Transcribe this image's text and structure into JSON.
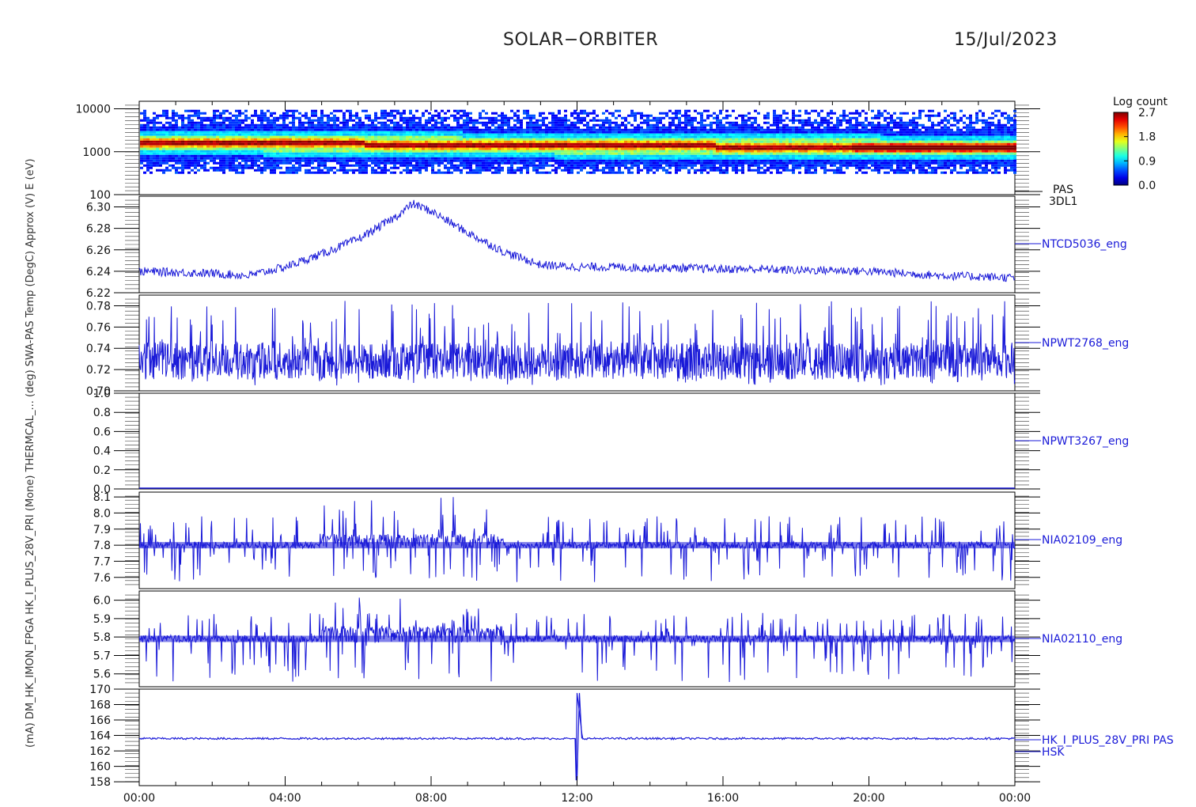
{
  "header": {
    "title": "SOLAR−ORBITER",
    "date": "15/Jul/2023"
  },
  "colors": {
    "trace": "#1a1ad8",
    "axis": "#000000",
    "label": "#1a1ad8"
  },
  "colorbar": {
    "title": "Log count",
    "ticks": [
      "2.7",
      "1.8",
      "0.9",
      "0.0"
    ],
    "range": [
      0.0,
      2.7
    ]
  },
  "ylabel_overlap": "(mA) DM_HK_IMON_FPGA HK_I_PLUS_28V_PRI (Mone) THERMCAL_... (deg) SWA-PAS Temp (DegC) Approx (V) E (eV)",
  "chart_data": [
    {
      "type": "heatmap",
      "name": "PAS 3DL1",
      "label": [
        "PAS",
        "3DL1"
      ],
      "y_scale": "log",
      "ylim": [
        100,
        15000
      ],
      "yticks": [
        "10000",
        "1000",
        "100"
      ],
      "z_range": [
        0.0,
        2.7
      ],
      "band_center_eV": [
        1700,
        1700,
        1650,
        1600,
        1550,
        1500,
        1450,
        1450,
        1400,
        1400,
        1350,
        1300
      ],
      "band_center_hours": [
        0,
        2,
        4,
        6,
        8,
        10,
        12,
        14,
        16,
        18,
        20,
        24
      ]
    },
    {
      "type": "line",
      "name": "NTCD5036_eng",
      "label": "NTCD5036_eng",
      "ylim": [
        6.22,
        6.31
      ],
      "yticks": [
        "6.30",
        "6.28",
        "6.26",
        "6.24",
        "6.22"
      ],
      "x_hours": [
        0,
        1,
        2,
        3,
        4,
        5,
        6,
        7,
        7.5,
        8,
        9,
        10,
        11,
        12,
        13,
        14,
        15,
        16,
        17,
        18,
        19,
        20,
        21,
        22,
        23,
        24
      ],
      "y": [
        6.24,
        6.239,
        6.238,
        6.236,
        6.244,
        6.256,
        6.27,
        6.29,
        6.303,
        6.296,
        6.276,
        6.258,
        6.246,
        6.244,
        6.244,
        6.243,
        6.243,
        6.242,
        6.242,
        6.241,
        6.241,
        6.24,
        6.238,
        6.236,
        6.235,
        6.234
      ]
    },
    {
      "type": "line",
      "name": "NPWT2768_eng",
      "label": "NPWT2768_eng",
      "ylim": [
        0.7,
        0.79
      ],
      "yticks": [
        "0.78",
        "0.76",
        "0.74",
        "0.72",
        "0.70"
      ],
      "baseline": 0.728,
      "range_min": 0.705,
      "range_max": 0.785
    },
    {
      "type": "line",
      "name": "NPWT3267_eng",
      "label": "NPWT3267_eng",
      "ylim": [
        0.0,
        1.0
      ],
      "yticks": [
        "1.0",
        "0.8",
        "0.6",
        "0.4",
        "0.2",
        "0.0"
      ],
      "baseline": 0.0
    },
    {
      "type": "line",
      "name": "NIA02109_eng",
      "label": "NIA02109_eng",
      "ylim": [
        7.53,
        8.13
      ],
      "yticks": [
        "8.1",
        "8.0",
        "7.9",
        "7.8",
        "7.7",
        "7.6"
      ],
      "levels": [
        7.8,
        7.85
      ],
      "elevated_hours": [
        5,
        10
      ],
      "range_min": 7.57,
      "range_max": 8.1
    },
    {
      "type": "line",
      "name": "NIA02110_eng",
      "label": "NIA02110_eng",
      "ylim": [
        5.53,
        6.05
      ],
      "yticks": [
        "6.0",
        "5.9",
        "5.8",
        "5.7",
        "5.6"
      ],
      "levels": [
        5.79,
        5.84
      ],
      "elevated_hours": [
        5,
        10
      ],
      "range_min": 5.55,
      "range_max": 6.03
    },
    {
      "type": "line",
      "name": "HK_I_PLUS_28V_PRI PAS HSK",
      "label": [
        "HK_I_PLUS_28V_PRI PAS",
        "HSK"
      ],
      "ylim": [
        157.5,
        170
      ],
      "yticks": [
        "170",
        "168",
        "166",
        "164",
        "162",
        "160",
        "158"
      ],
      "baseline": 163.6,
      "spike_hour": 12.0,
      "spike_min": 158.2,
      "spike_max": 169.5
    }
  ],
  "xaxis": {
    "ticks": [
      "00:00",
      "04:00",
      "08:00",
      "12:00",
      "16:00",
      "20:00",
      "00:00"
    ],
    "range_hours": [
      0,
      24
    ]
  }
}
